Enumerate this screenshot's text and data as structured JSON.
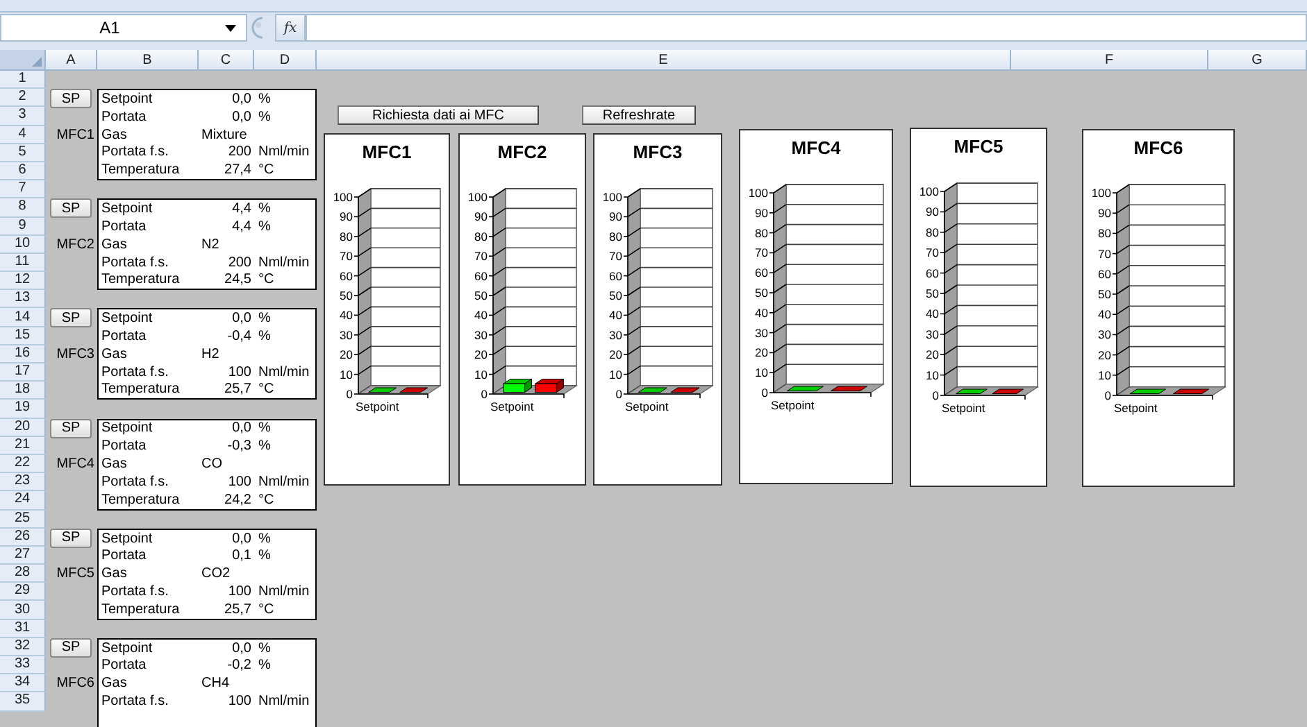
{
  "name_box": {
    "value": "A1"
  },
  "formula_bar": {
    "function_label": "fx"
  },
  "columns": [
    "A",
    "B",
    "C",
    "D",
    "E",
    "F",
    "G"
  ],
  "rows": [
    "1",
    "2",
    "3",
    "4",
    "5",
    "6",
    "7",
    "8",
    "9",
    "10",
    "11",
    "12",
    "13",
    "14",
    "15",
    "16",
    "17",
    "18",
    "19",
    "20",
    "21",
    "22",
    "23",
    "24",
    "25",
    "26",
    "27",
    "28",
    "29",
    "30",
    "31",
    "32",
    "33",
    "34",
    "35"
  ],
  "mfcs": [
    {
      "button": "SP",
      "name": "MFC1",
      "fields": [
        {
          "kind": "number",
          "label": "Setpoint",
          "value": "0,0",
          "unit": "%"
        },
        {
          "kind": "number",
          "label": "Portata",
          "value": "0,0",
          "unit": "%"
        },
        {
          "kind": "text",
          "label": "Gas",
          "value": "Mixture"
        },
        {
          "kind": "number",
          "label": "Portata f.s.",
          "value": "200",
          "unit": "Nml/min"
        },
        {
          "kind": "number",
          "label": "Temperatura",
          "value": "27,4",
          "unit": "°C"
        }
      ]
    },
    {
      "button": "SP",
      "name": "MFC2",
      "fields": [
        {
          "kind": "number",
          "label": "Setpoint",
          "value": "4,4",
          "unit": "%"
        },
        {
          "kind": "number",
          "label": "Portata",
          "value": "4,4",
          "unit": "%"
        },
        {
          "kind": "text",
          "label": "Gas",
          "value": "N2"
        },
        {
          "kind": "number",
          "label": "Portata f.s.",
          "value": "200",
          "unit": "Nml/min"
        },
        {
          "kind": "number",
          "label": "Temperatura",
          "value": "24,5",
          "unit": "°C"
        }
      ]
    },
    {
      "button": "SP",
      "name": "MFC3",
      "fields": [
        {
          "kind": "number",
          "label": "Setpoint",
          "value": "0,0",
          "unit": "%"
        },
        {
          "kind": "number",
          "label": "Portata",
          "value": "-0,4",
          "unit": "%"
        },
        {
          "kind": "text",
          "label": "Gas",
          "value": "H2"
        },
        {
          "kind": "number",
          "label": "Portata f.s.",
          "value": "100",
          "unit": "Nml/min"
        },
        {
          "kind": "number",
          "label": "Temperatura",
          "value": "25,7",
          "unit": "°C"
        }
      ]
    },
    {
      "button": "SP",
      "name": "MFC4",
      "fields": [
        {
          "kind": "number",
          "label": "Setpoint",
          "value": "0,0",
          "unit": "%"
        },
        {
          "kind": "number",
          "label": "Portata",
          "value": "-0,3",
          "unit": "%"
        },
        {
          "kind": "text",
          "label": "Gas",
          "value": "CO"
        },
        {
          "kind": "number",
          "label": "Portata f.s.",
          "value": "100",
          "unit": "Nml/min"
        },
        {
          "kind": "number",
          "label": "Temperatura",
          "value": "24,2",
          "unit": "°C"
        }
      ]
    },
    {
      "button": "SP",
      "name": "MFC5",
      "fields": [
        {
          "kind": "number",
          "label": "Setpoint",
          "value": "0,0",
          "unit": "%"
        },
        {
          "kind": "number",
          "label": "Portata",
          "value": "0,1",
          "unit": "%"
        },
        {
          "kind": "text",
          "label": "Gas",
          "value": "CO2"
        },
        {
          "kind": "number",
          "label": "Portata f.s.",
          "value": "100",
          "unit": "Nml/min"
        },
        {
          "kind": "number",
          "label": "Temperatura",
          "value": "25,7",
          "unit": "°C"
        }
      ]
    },
    {
      "button": "SP",
      "name": "MFC6",
      "fields": [
        {
          "kind": "number",
          "label": "Setpoint",
          "value": "0,0",
          "unit": "%"
        },
        {
          "kind": "number",
          "label": "Portata",
          "value": "-0,2",
          "unit": "%"
        },
        {
          "kind": "text",
          "label": "Gas",
          "value": "CH4"
        },
        {
          "kind": "number",
          "label": "Portata f.s.",
          "value": "100",
          "unit": "Nml/min"
        }
      ]
    }
  ],
  "buttons": [
    "Richiesta dati ai MFC",
    "Refreshrate"
  ],
  "charts": [
    {
      "chart_data": {
        "type": "bar",
        "title": "MFC1",
        "categories": [
          "Setpoint"
        ],
        "series": [
          {
            "color": "#00ff00",
            "values": [
              0
            ]
          },
          {
            "color": "#ff0000",
            "values": [
              0
            ]
          }
        ],
        "ylim": [
          0,
          100
        ],
        "yticks": [
          0,
          10,
          20,
          30,
          40,
          50,
          60,
          70,
          80,
          90,
          100
        ]
      }
    },
    {
      "chart_data": {
        "type": "bar",
        "title": "MFC2",
        "categories": [
          "Setpoint"
        ],
        "series": [
          {
            "color": "#00ff00",
            "values": [
              4.4
            ]
          },
          {
            "color": "#ff0000",
            "values": [
              4.4
            ]
          }
        ],
        "ylim": [
          0,
          100
        ],
        "yticks": [
          0,
          10,
          20,
          30,
          40,
          50,
          60,
          70,
          80,
          90,
          100
        ]
      }
    },
    {
      "chart_data": {
        "type": "bar",
        "title": "MFC3",
        "categories": [
          "Setpoint"
        ],
        "series": [
          {
            "color": "#00ff00",
            "values": [
              0
            ]
          },
          {
            "color": "#ff0000",
            "values": [
              0
            ]
          }
        ],
        "ylim": [
          0,
          100
        ],
        "yticks": [
          0,
          10,
          20,
          30,
          40,
          50,
          60,
          70,
          80,
          90,
          100
        ]
      }
    },
    {
      "chart_data": {
        "type": "bar",
        "title": "MFC4",
        "categories": [
          "Setpoint"
        ],
        "series": [
          {
            "color": "#00ff00",
            "values": [
              0
            ]
          },
          {
            "color": "#ff0000",
            "values": [
              0
            ]
          }
        ],
        "ylim": [
          0,
          100
        ],
        "yticks": [
          0,
          10,
          20,
          30,
          40,
          50,
          60,
          70,
          80,
          90,
          100
        ]
      }
    },
    {
      "chart_data": {
        "type": "bar",
        "title": "MFC5",
        "categories": [
          "Setpoint"
        ],
        "series": [
          {
            "color": "#00ff00",
            "values": [
              0
            ]
          },
          {
            "color": "#ff0000",
            "values": [
              0
            ]
          }
        ],
        "ylim": [
          0,
          100
        ],
        "yticks": [
          0,
          10,
          20,
          30,
          40,
          50,
          60,
          70,
          80,
          90,
          100
        ]
      }
    },
    {
      "chart_data": {
        "type": "bar",
        "title": "MFC6",
        "categories": [
          "Setpoint"
        ],
        "series": [
          {
            "color": "#00ff00",
            "values": [
              0
            ]
          },
          {
            "color": "#ff0000",
            "values": [
              0
            ]
          }
        ],
        "ylim": [
          0,
          100
        ],
        "yticks": [
          0,
          10,
          20,
          30,
          40,
          50,
          60,
          70,
          80,
          90,
          100
        ]
      }
    }
  ]
}
